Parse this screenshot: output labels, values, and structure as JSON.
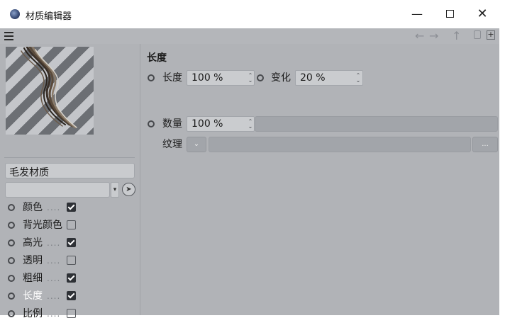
{
  "window": {
    "title": "材质编辑器",
    "minimize_label": "—",
    "close_label": "✕"
  },
  "menubar": {
    "icons": [
      "menu-icon",
      "back-arrow-icon",
      "forward-arrow-icon",
      "up-arrow-icon",
      "lock-icon",
      "new-window-icon"
    ]
  },
  "material": {
    "name": "毛发材质"
  },
  "channels": [
    {
      "label": "颜色",
      "dots": "....",
      "checked": true,
      "active": false
    },
    {
      "label": "背光颜色",
      "dots": "",
      "checked": false,
      "active": false
    },
    {
      "label": "高光",
      "dots": "....",
      "checked": true,
      "active": false
    },
    {
      "label": "透明",
      "dots": "....",
      "checked": false,
      "active": false
    },
    {
      "label": "粗细",
      "dots": "....",
      "checked": true,
      "active": false
    },
    {
      "label": "长度",
      "dots": "....",
      "checked": true,
      "active": true
    },
    {
      "label": "比例",
      "dots": "....",
      "checked": false,
      "active": false
    }
  ],
  "length_section": {
    "title": "长度",
    "length_label": "长度",
    "length_value": "100 %",
    "variation_label": "变化",
    "variation_value": "20 %",
    "count_label": "数量",
    "count_value": "100 %",
    "texture_label": "纹理",
    "texture_menu": "⌄",
    "texture_more": "..."
  },
  "colors": {
    "panel_bg": "#b1b3b7",
    "field_bg": "#cacccf",
    "active_text": "#ffffff"
  }
}
